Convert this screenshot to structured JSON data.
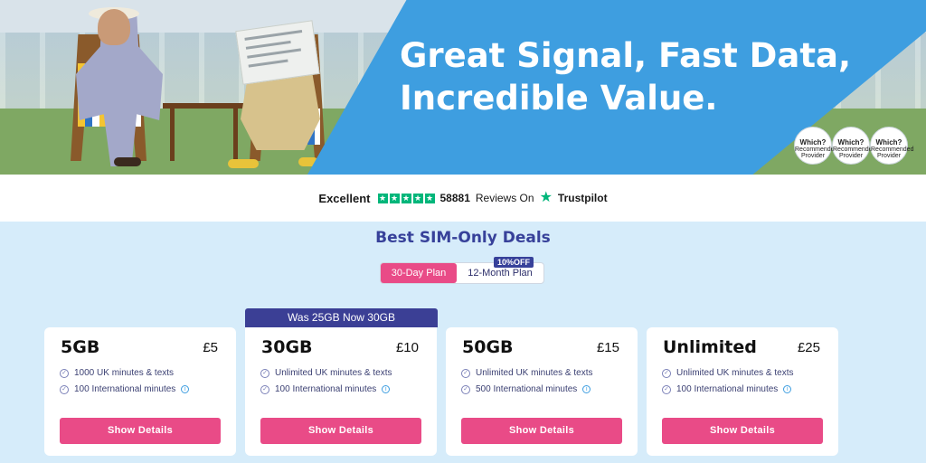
{
  "hero": {
    "title_line1": "Great Signal, Fast Data,",
    "title_line2": "Incredible Value.",
    "badges": [
      {
        "label": "Which?",
        "sub": "Recommended Provider"
      },
      {
        "label": "Which?",
        "sub": "Recommended Provider"
      },
      {
        "label": "Which?",
        "sub": "Recommended Provider"
      }
    ]
  },
  "trustpilot": {
    "rating_text": "Excellent",
    "review_count": "58881",
    "reviews_on": "Reviews On",
    "brand": "Trustpilot"
  },
  "deals": {
    "title": "Best SIM-Only Deals",
    "toggle_30": "30-Day Plan",
    "toggle_12": "12-Month Plan",
    "discount_badge": "10%OFF",
    "ribbon": "Was 25GB Now 30GB",
    "cards": [
      {
        "name": "5GB",
        "price": "£5",
        "f1": "1000 UK minutes & texts",
        "f2": "100 International minutes",
        "button": "Show Details"
      },
      {
        "name": "30GB",
        "price": "£10",
        "f1": "Unlimited UK minutes & texts",
        "f2": "100 International minutes",
        "button": "Show Details"
      },
      {
        "name": "50GB",
        "price": "£15",
        "f1": "Unlimited UK minutes & texts",
        "f2": "500 International minutes",
        "button": "Show Details"
      },
      {
        "name": "Unlimited",
        "price": "£25",
        "f1": "Unlimited UK minutes & texts",
        "f2": "100 International minutes",
        "button": "Show Details"
      }
    ]
  },
  "colors": {
    "brand_pink": "#e94b87",
    "brand_navy": "#37419a",
    "hero_blue": "#3e9ee0",
    "trust_green": "#00b67a",
    "page_bg": "#d6ecfa"
  }
}
